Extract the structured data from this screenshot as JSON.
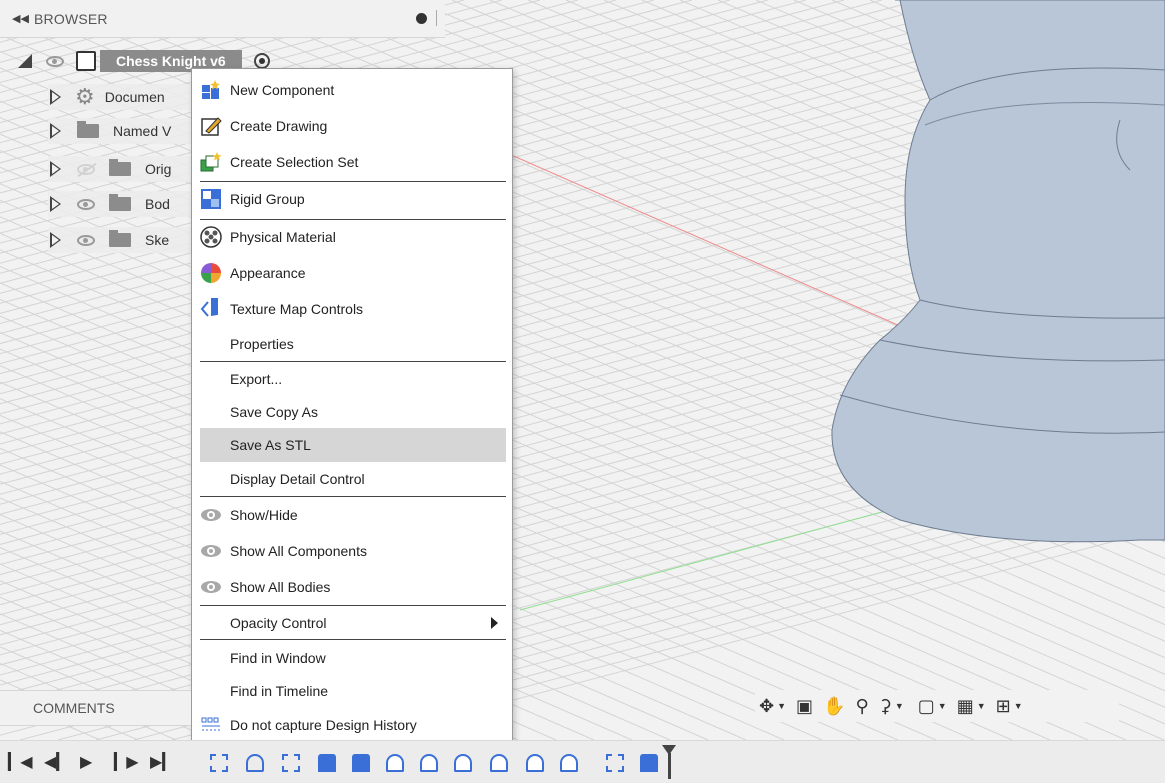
{
  "browser": {
    "title": "BROWSER",
    "root": {
      "label": "Chess Knight v6"
    },
    "items": [
      {
        "label": "Documen",
        "icon": "gear-icon"
      },
      {
        "label": "Named V",
        "icon": "folder-icon"
      },
      {
        "label": "Orig",
        "icon": "folder-icon",
        "visibility": "hidden"
      },
      {
        "label": "Bod",
        "icon": "folder-icon",
        "visibility": "visible"
      },
      {
        "label": "Ske",
        "icon": "folder-icon",
        "visibility": "visible"
      }
    ]
  },
  "context_menu": {
    "items": [
      {
        "label": "New Component",
        "icon": "new-component-icon"
      },
      {
        "label": "Create Drawing",
        "icon": "create-drawing-icon"
      },
      {
        "label": "Create Selection Set",
        "icon": "selection-set-icon"
      },
      {
        "label": "Rigid Group",
        "icon": "rigid-group-icon"
      },
      {
        "label": "Physical Material",
        "icon": "physical-material-icon"
      },
      {
        "label": "Appearance",
        "icon": "appearance-icon"
      },
      {
        "label": "Texture Map Controls",
        "icon": "texture-map-icon"
      },
      {
        "label": "Properties"
      },
      {
        "label": "Export..."
      },
      {
        "label": "Save Copy As"
      },
      {
        "label": "Save As STL",
        "highlighted": true
      },
      {
        "label": "Display Detail Control"
      },
      {
        "label": "Show/Hide",
        "icon": "eye-icon"
      },
      {
        "label": "Show All Components",
        "icon": "eye-icon"
      },
      {
        "label": "Show All Bodies",
        "icon": "eye-icon"
      },
      {
        "label": "Opacity Control",
        "submenu": true
      },
      {
        "label": "Find in Window"
      },
      {
        "label": "Find in Timeline"
      },
      {
        "label": "Do not capture Design History",
        "icon": "design-history-icon"
      }
    ]
  },
  "comments": {
    "title": "COMMENTS"
  },
  "colors": {
    "accent_blue": "#3a6fd8",
    "highlight": "#d6d6d6",
    "selected_node": "#8b8b8b",
    "model": "#b9c6d8"
  }
}
